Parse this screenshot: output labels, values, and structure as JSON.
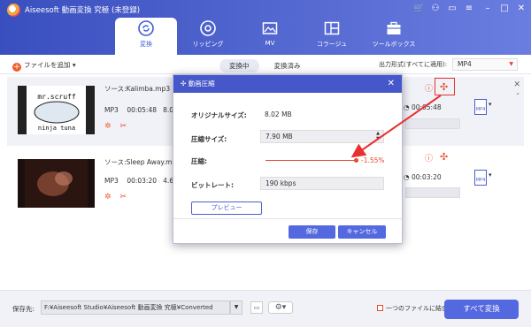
{
  "app": {
    "title": "Aiseesoft 動画変換 究極 (未登録)"
  },
  "nav": {
    "tabs": [
      {
        "label": "変換",
        "icon": "convert-icon"
      },
      {
        "label": "リッピング",
        "icon": "ripper-icon"
      },
      {
        "label": "MV",
        "icon": "mv-icon"
      },
      {
        "label": "コラージュ",
        "icon": "collage-icon"
      },
      {
        "label": "ツールボックス",
        "icon": "toolbox-icon"
      }
    ]
  },
  "toolbar": {
    "add_files": "ファイルを追加",
    "tab_converting": "変換中",
    "tab_converted": "変換済み",
    "output_format_label": "出力形式(すべてに適用):",
    "output_format_value": "MP4"
  },
  "files": [
    {
      "source": "ソース:Kalimba.mp3",
      "format": "MP3",
      "duration": "00:05:48",
      "size_prefix": "8.0",
      "out_duration": "00:05:48",
      "thumb_text_1": "mr.scruff",
      "thumb_text_2": "ninja tuna"
    },
    {
      "source": "ソース:Sleep Away.mp",
      "format": "MP3",
      "duration": "00:03:20",
      "size_prefix": "4.6",
      "out_duration": "00:03:20"
    }
  ],
  "dialog": {
    "title": "動画圧縮",
    "original_size_label": "オリジナルサイズ:",
    "original_size_value": "8.02 MB",
    "compress_size_label": "圧縮サイズ:",
    "compress_size_value": "7.90 MB",
    "compression_label": "圧縮:",
    "compression_value": "-1.55%",
    "bitrate_label": "ビットレート:",
    "bitrate_value": "190 kbps",
    "preview_button": "プレビュー",
    "save_button": "保存",
    "cancel_button": "キャンセル"
  },
  "bottom": {
    "save_to_label": "保存先:",
    "save_path": "F:¥Aiseesoft Studio¥Aiseesoft 動画変換 究極¥Converted",
    "merge_label": "一つのファイルに結合",
    "convert_all_button": "すべて変換"
  },
  "colors": {
    "accent": "#5468e0",
    "header": "#4657c9",
    "highlight": "#e83030"
  }
}
